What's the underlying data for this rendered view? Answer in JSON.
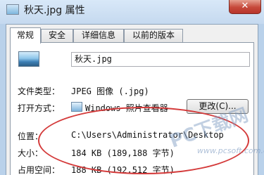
{
  "window": {
    "title": "秋天.jpg 属性",
    "close_label": "✕"
  },
  "tabs": [
    {
      "label": "常规"
    },
    {
      "label": "安全"
    },
    {
      "label": "详细信息"
    },
    {
      "label": "以前的版本"
    }
  ],
  "general": {
    "file_name": "秋天.jpg",
    "type_label": "文件类型：",
    "type_value": "JPEG 图像 (.jpg)",
    "open_label": "打开方式：",
    "open_value": "Windows 照片查看器",
    "change_button": "更改(C)...",
    "location_label": "位置：",
    "location_value": "C:\\Users\\Administrator\\Desktop",
    "size_label": "大小：",
    "size_value": "184 KB (189,188 字节)",
    "disk_label": "占用空间：",
    "disk_value": "188 KB (192,512 字节)"
  },
  "watermark": {
    "text": "PC下载网",
    "url": "www.pcsoft.com.cn"
  }
}
